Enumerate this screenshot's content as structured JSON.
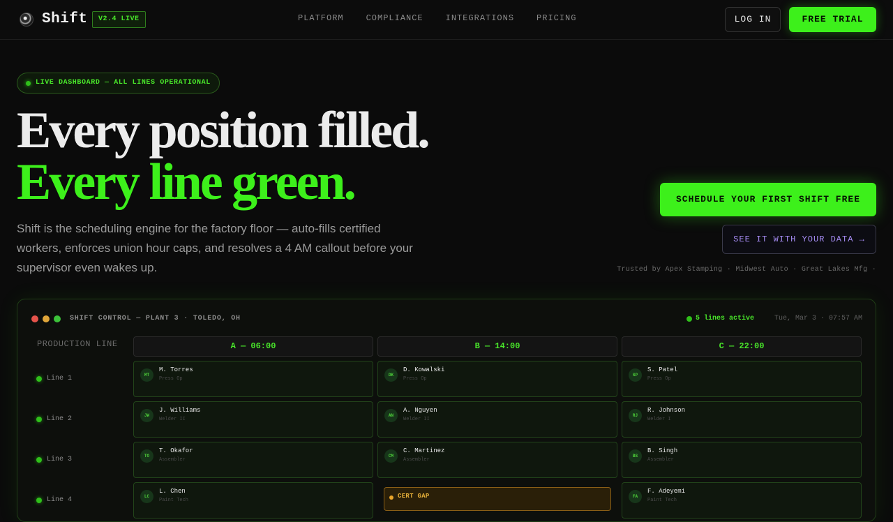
{
  "nav": {
    "logo_icon": "gear-logo-icon",
    "brand": "Shift",
    "version": "V2.4 LIVE",
    "links": [
      "PLATFORM",
      "COMPLIANCE",
      "INTEGRATIONS",
      "PRICING"
    ],
    "login": "LOG IN",
    "trial": "FREE TRIAL"
  },
  "hero": {
    "status_pill": "LIVE DASHBOARD — ALL LINES OPERATIONAL",
    "headline_1": "Every position filled.",
    "headline_2": "Every line green.",
    "subtext": "Shift is the scheduling engine for the factory floor — auto-fills certified workers, enforces union hour caps, and resolves a 4 AM callout before your supervisor even wakes up.",
    "cta_primary": "SCHEDULE YOUR FIRST SHIFT FREE",
    "cta_secondary": "SEE IT WITH YOUR DATA →",
    "trusted_by": "Trusted by  Apex Stamping ·  Midwest Auto ·  Great Lakes Mfg ·"
  },
  "dashboard": {
    "title": "SHIFT CONTROL — PLANT 3 · TOLEDO, OH",
    "lines_active": "5 lines active",
    "date": "Tue, Mar 3 · 07:57 AM",
    "production_header": "PRODUCTION LINE",
    "shifts": [
      "A — 06:00",
      "B — 14:00",
      "C — 22:00"
    ],
    "lines": [
      {
        "label": "Line 1",
        "cells": [
          {
            "initials": "MT",
            "name": "M. Torres",
            "role": "Press Op"
          },
          {
            "initials": "DK",
            "name": "D. Kowalski",
            "role": "Press Op"
          },
          {
            "initials": "SP",
            "name": "S. Patel",
            "role": "Press Op"
          }
        ]
      },
      {
        "label": "Line 2",
        "cells": [
          {
            "initials": "JW",
            "name": "J. Williams",
            "role": "Welder II"
          },
          {
            "initials": "AN",
            "name": "A. Nguyen",
            "role": "Welder II"
          },
          {
            "initials": "RJ",
            "name": "R. Johnson",
            "role": "Welder I"
          }
        ]
      },
      {
        "label": "Line 3",
        "cells": [
          {
            "initials": "TO",
            "name": "T. Okafor",
            "role": "Assembler"
          },
          {
            "initials": "CM",
            "name": "C. Martinez",
            "role": "Assembler"
          },
          {
            "initials": "BS",
            "name": "B. Singh",
            "role": "Assembler"
          }
        ]
      },
      {
        "label": "Line 4",
        "cells": [
          {
            "initials": "LC",
            "name": "L. Chen",
            "role": "Paint Tech"
          },
          {
            "gap": "CERT GAP"
          },
          {
            "initials": "FA",
            "name": "F. Adeyemi",
            "role": "Paint Tech"
          }
        ]
      }
    ]
  },
  "colors": {
    "accent_green": "#3df01b",
    "background": "#0b0b0b",
    "warning_amber": "#e8b13a",
    "secondary_purple": "#a58bf2"
  }
}
